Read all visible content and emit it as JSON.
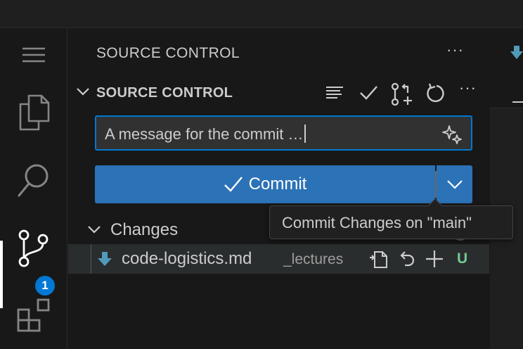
{
  "activity_bar": {
    "items": [
      {
        "icon": "menu-icon"
      },
      {
        "icon": "files-icon"
      },
      {
        "icon": "search-icon"
      },
      {
        "icon": "source-control-icon",
        "badge": "1",
        "active": true
      },
      {
        "icon": "extensions-icon"
      }
    ]
  },
  "sidebar": {
    "title": "SOURCE CONTROL",
    "more_label": "···",
    "section": {
      "title": "SOURCE CONTROL",
      "more_label": "···"
    },
    "commit_message": {
      "placeholder": "A message for the commit …"
    },
    "commit_button": {
      "label": "Commit"
    },
    "changes": {
      "label": "Changes",
      "files": [
        {
          "name": "code-logistics.md",
          "dir": "_lectures",
          "status": "U"
        }
      ]
    }
  },
  "tooltip": {
    "text": "Commit Changes on \"main\""
  },
  "colors": {
    "accent": "#0078d4",
    "button": "#2c72b7",
    "untracked": "#73c991",
    "background": "#181818"
  }
}
